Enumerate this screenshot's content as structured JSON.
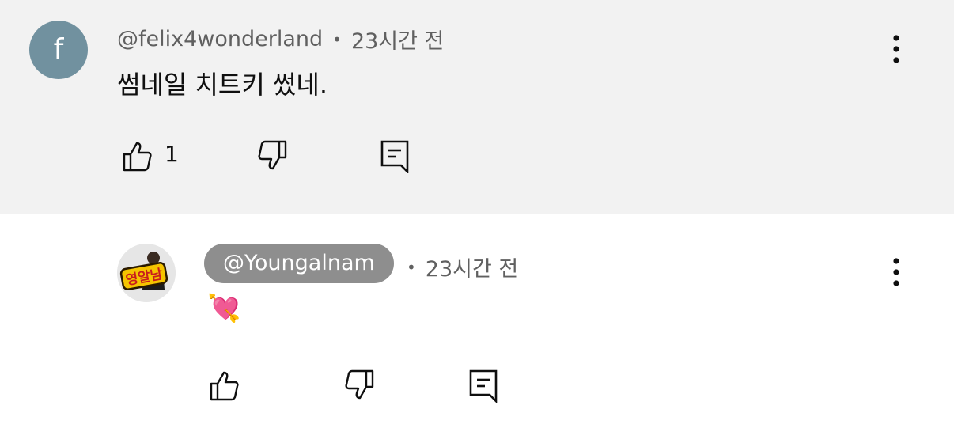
{
  "comments": [
    {
      "avatar_letter": "f",
      "author": "@felix4wonderland",
      "separator": "•",
      "time": "23시간 전",
      "text": "썸네일 치트키 썼네.",
      "like_count": "1",
      "avatar_color": "#71919f",
      "background": "#f2f2f2"
    },
    {
      "author": "@Youngalnam",
      "separator": "•",
      "time": "23시간 전",
      "text": "💘",
      "logo_text": "영알남",
      "chip_color": "#8e8e8e",
      "logo_color": "#f5c400"
    }
  ],
  "icons": {
    "like": "thumbs-up-icon",
    "dislike": "thumbs-down-icon",
    "reply": "comment-reply-icon",
    "more": "more-vertical-icon"
  }
}
